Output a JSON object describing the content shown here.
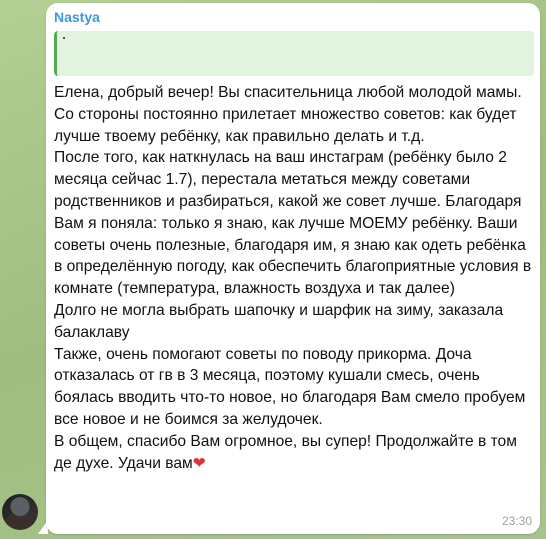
{
  "chat": {
    "sender": "Nastya",
    "time": "23:30",
    "heart": "❤",
    "message_paragraphs": [
      "Елена, добрый вечер! Вы спасительница любой молодой мамы. Со стороны постоянно прилетает множество советов: как будет лучше твоему ребёнку, как правильно делать и т.д.",
      "После того, как наткнулась на ваш инстаграм (ребёнку было 2 месяца  сейчас 1.7), перестала метаться между советами родственников и разбираться, какой же совет лучше. Благодаря Вам я поняла: только я знаю, как лучше МОЕМУ ребёнку. Ваши советы очень полезные, благодаря им, я знаю как одеть ребёнка в определённую погоду, как обеспечить благоприятные условия в комнате (температура, влажность воздуха и так далее)",
      "Долго не могла выбрать шапочку и шарфик на зиму, заказала балаклаву",
      "Также, очень помогают советы по поводу прикорма. Доча отказалась от гв в 3 месяца, поэтому кушали смесь, очень боялась вводить что-то новое, но благодаря Вам смело пробуем все новое и не боимся за желудочек.",
      "В общем, спасибо Вам огромное, вы супер! Продолжайте в том де духе. Удачи вам"
    ]
  }
}
